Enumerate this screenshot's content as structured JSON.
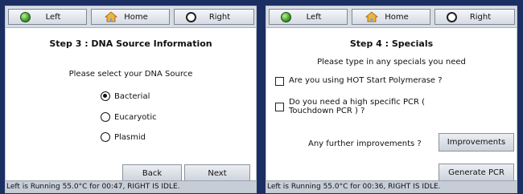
{
  "topbar": {
    "left_label": "Left",
    "home_label": "Home",
    "right_label": "Right"
  },
  "left_screen": {
    "heading": "Step 3 : DNA Source Information",
    "prompt": "Please select your DNA Source",
    "options": [
      {
        "label": "Bacterial",
        "selected": true
      },
      {
        "label": "Eucaryotic",
        "selected": false
      },
      {
        "label": "Plasmid",
        "selected": false
      }
    ],
    "back_label": "Back",
    "next_label": "Next",
    "status": "Left is Running 55.0°C for 00:47, RIGHT IS IDLE."
  },
  "right_screen": {
    "heading": "Step 4 : Specials",
    "prompt": "Please type in any specials you need",
    "checkboxes": [
      {
        "label": "Are you using HOT Start Polymerase ?",
        "checked": false
      },
      {
        "label_line1": "Do you need a high specific PCR (",
        "label_line2": "Touchdown PCR ) ?",
        "checked": false
      }
    ],
    "improvements_prompt": "Any further improvements ?",
    "improvements_label": "Improvements",
    "generate_label": "Generate PCR",
    "status": "Left is Running 55.0°C for 00:36, RIGHT IS IDLE."
  },
  "colors": {
    "background": "#1b2f63",
    "led_active": "#3f9c25",
    "status_bar": "#c7cdd6"
  },
  "icons": {
    "left_button": "green-led-icon",
    "home_button": "home-icon",
    "right_button": "empty-ring-icon"
  }
}
